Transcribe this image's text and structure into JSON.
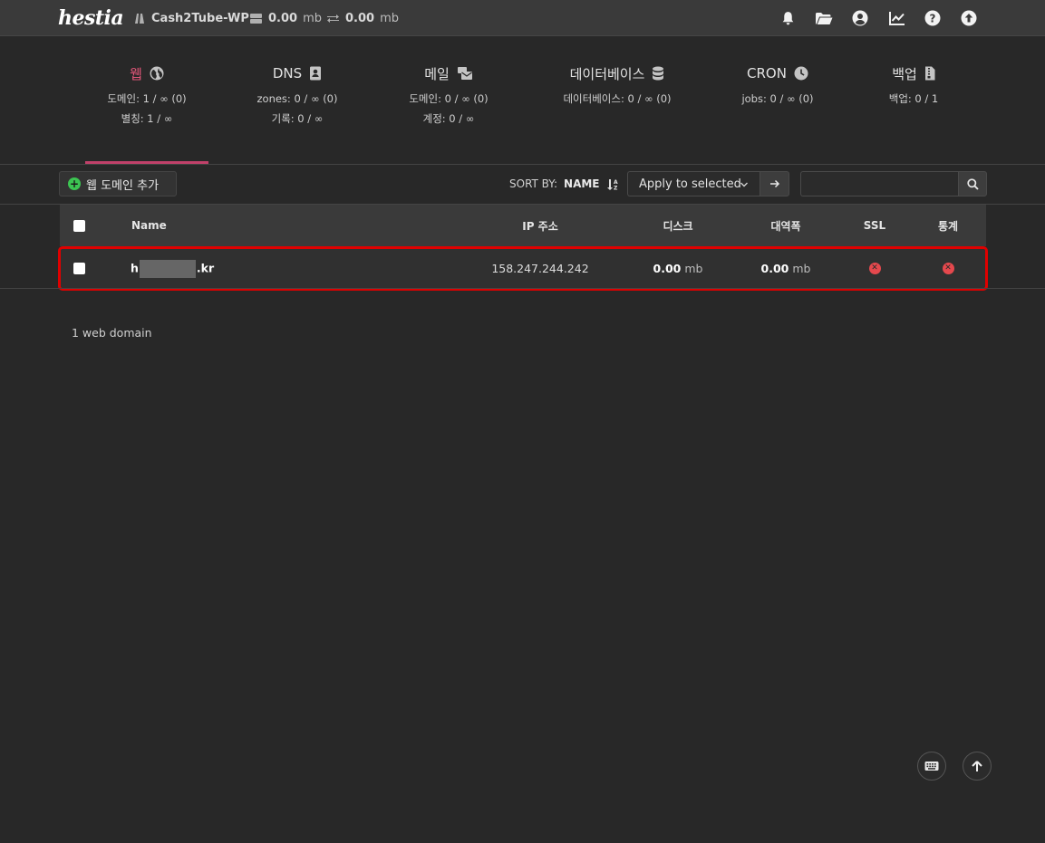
{
  "topbar": {
    "logo": "hestia",
    "user": "Cash2Tube-WP",
    "disk_value": "0.00",
    "disk_unit": "mb",
    "bandwidth_value": "0.00",
    "bandwidth_unit": "mb",
    "icons": [
      "bell-icon",
      "folder-icon",
      "user-circle-icon",
      "chart-line-icon",
      "help-icon",
      "arrow-up-circle-icon"
    ]
  },
  "stats": [
    {
      "title": "웹",
      "icon": "globe-icon",
      "lines": [
        "도메인: 1 / ∞ (0)",
        "별칭: 1 / ∞"
      ],
      "active": true
    },
    {
      "title": "DNS",
      "icon": "address-book-icon",
      "lines": [
        "zones: 0 / ∞ (0)",
        "기록: 0 / ∞"
      ],
      "active": false
    },
    {
      "title": "메일",
      "icon": "mail-bulk-icon",
      "lines": [
        "도메인: 0 / ∞ (0)",
        "계정: 0 / ∞"
      ],
      "active": false
    },
    {
      "title": "데이터베이스",
      "icon": "database-icon",
      "lines": [
        "데이터베이스: 0 / ∞ (0)"
      ],
      "active": false
    },
    {
      "title": "CRON",
      "icon": "clock-icon",
      "lines": [
        "jobs: 0 / ∞ (0)"
      ],
      "active": false
    },
    {
      "title": "백업",
      "icon": "file-zip-icon",
      "lines": [
        "백업: 0 / 1"
      ],
      "active": false
    }
  ],
  "toolbar": {
    "add_label": "웹 도메인 추가",
    "sort_label": "SORT BY:",
    "sort_value": "NAME",
    "apply_label": "Apply to selected",
    "search_placeholder": ""
  },
  "table": {
    "headers": {
      "name": "Name",
      "ip": "IP 주소",
      "disk": "디스크",
      "bandwidth": "대역폭",
      "ssl": "SSL",
      "stats": "통계"
    },
    "rows": [
      {
        "name_start": "h",
        "name_end": ".kr",
        "ip": "158.247.244.242",
        "disk_value": "0.00",
        "disk_unit": "mb",
        "bw_value": "0.00",
        "bw_unit": "mb",
        "ssl": "disabled",
        "stats": "disabled"
      }
    ]
  },
  "footer": {
    "count_text": "1 web domain"
  },
  "colors": {
    "accent": "#c1416a",
    "highlight": "#e00000",
    "add_green": "#3cc552",
    "off_red": "#e5484d"
  }
}
